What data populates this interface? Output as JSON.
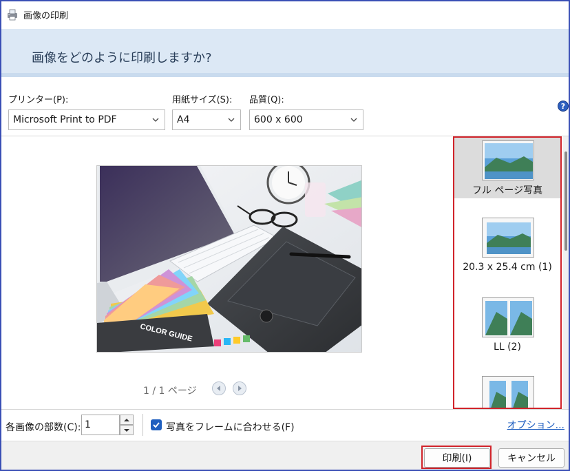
{
  "window": {
    "title": "画像の印刷"
  },
  "header": {
    "heading": "画像をどのように印刷しますか?"
  },
  "printer": {
    "label": "プリンター(P):",
    "value": "Microsoft Print to PDF"
  },
  "paper_size": {
    "label": "用紙サイズ(S):",
    "value": "A4"
  },
  "quality": {
    "label": "品質(Q):",
    "value": "600 x 600"
  },
  "help": {
    "glyph": "?"
  },
  "preview": {
    "pager_text": "1 / 1 ページ",
    "photo_text": "COLOR GUIDE"
  },
  "layouts": {
    "items": [
      {
        "label": "フル ページ写真",
        "selected": true
      },
      {
        "label": "20.3 x 25.4 cm (1)",
        "selected": false
      },
      {
        "label": "LL (2)",
        "selected": false
      },
      {
        "label": "",
        "selected": false
      }
    ]
  },
  "copies": {
    "label": "各画像の部数(C):",
    "value": "1"
  },
  "fit_frame": {
    "label": "写真をフレームに合わせる(F)",
    "checked": true
  },
  "options_link": "オプション...",
  "buttons": {
    "print": "印刷(I)",
    "cancel": "キャンセル"
  },
  "colors": {
    "accent": "#1f5fbf",
    "highlight": "#d1232a",
    "header_bg": "#dce8f5"
  }
}
